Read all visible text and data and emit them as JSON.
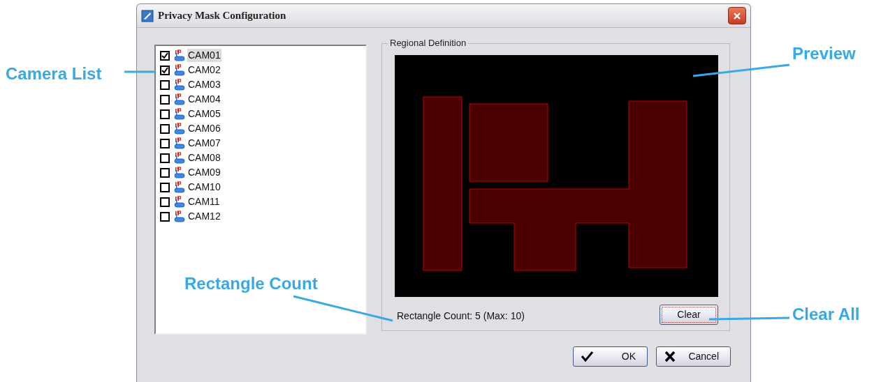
{
  "window": {
    "title": "Privacy Mask Configuration"
  },
  "cameras": [
    {
      "name": "CAM01",
      "checked": true,
      "selected": true
    },
    {
      "name": "CAM02",
      "checked": true,
      "selected": false
    },
    {
      "name": "CAM03",
      "checked": false,
      "selected": false
    },
    {
      "name": "CAM04",
      "checked": false,
      "selected": false
    },
    {
      "name": "CAM05",
      "checked": false,
      "selected": false
    },
    {
      "name": "CAM06",
      "checked": false,
      "selected": false
    },
    {
      "name": "CAM07",
      "checked": false,
      "selected": false
    },
    {
      "name": "CAM08",
      "checked": false,
      "selected": false
    },
    {
      "name": "CAM09",
      "checked": false,
      "selected": false
    },
    {
      "name": "CAM10",
      "checked": false,
      "selected": false
    },
    {
      "name": "CAM11",
      "checked": false,
      "selected": false
    },
    {
      "name": "CAM12",
      "checked": false,
      "selected": false
    }
  ],
  "region_group": {
    "title": "Regional Definition",
    "rectangle_count": "Rectangle Count: 5 (Max: 10)",
    "clear_button": "Clear"
  },
  "buttons": [
    {
      "kind": "ok",
      "label": "OK"
    },
    {
      "kind": "cancel",
      "label": "Cancel"
    }
  ],
  "annotations": [
    {
      "kind": "camera-list",
      "text": "Camera List"
    },
    {
      "kind": "preview",
      "text": "Preview"
    },
    {
      "kind": "rectangle-count",
      "text": "Rectangle Count"
    },
    {
      "kind": "clear",
      "text": "Clear All"
    }
  ]
}
